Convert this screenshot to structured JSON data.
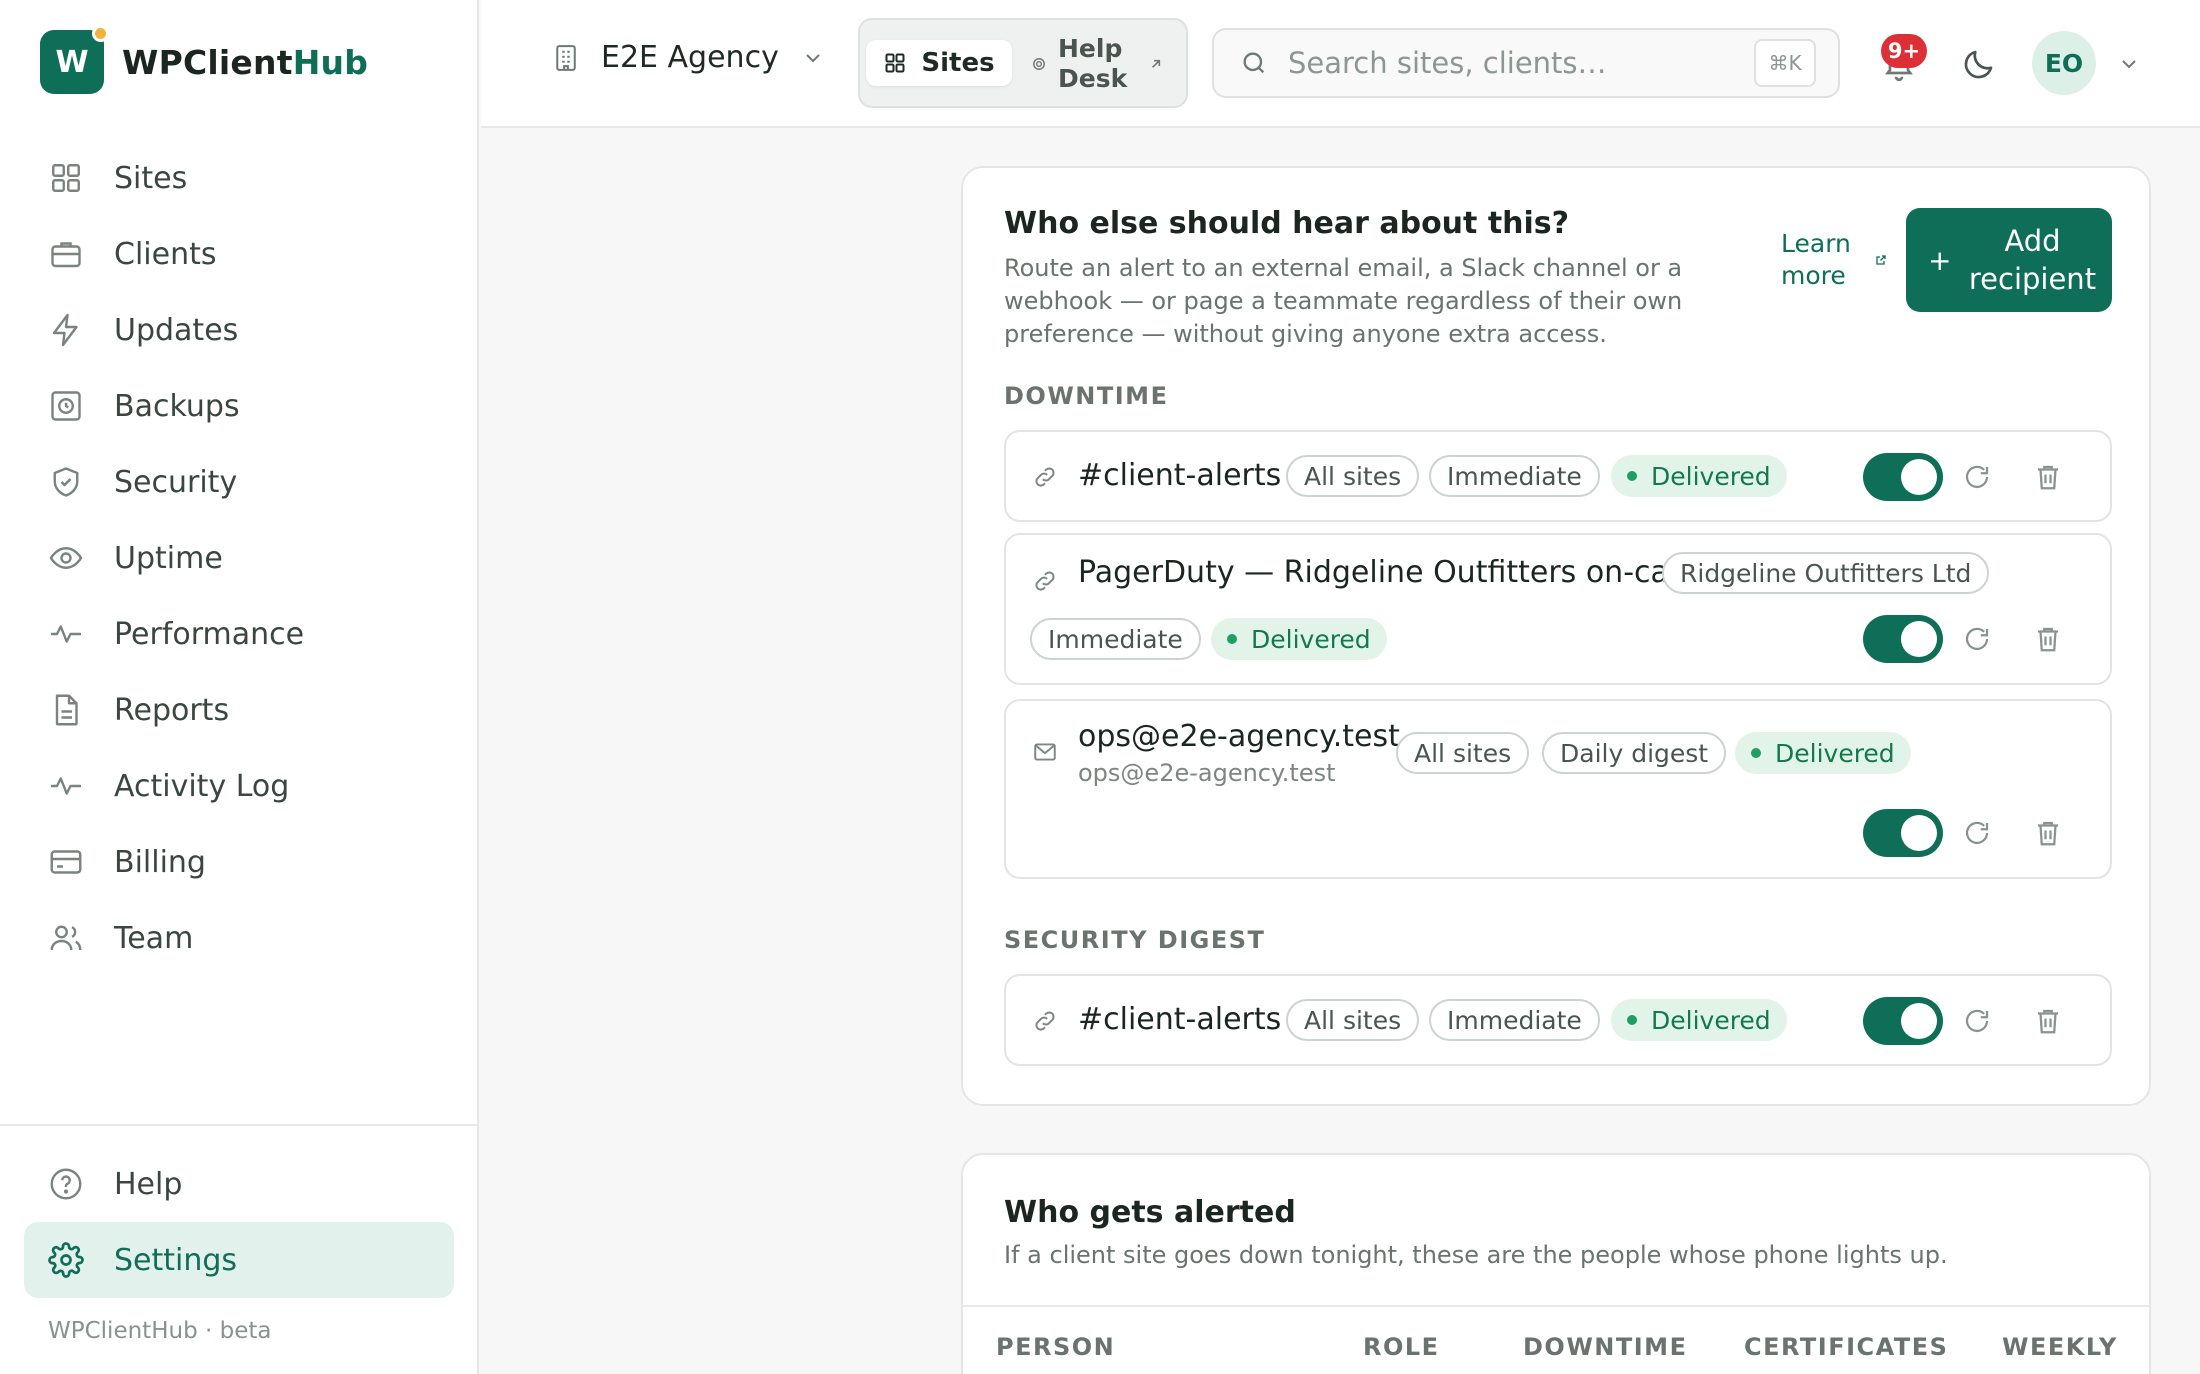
{
  "brand": {
    "mark": "W",
    "name_part1": "WPClient",
    "name_part2": "Hub"
  },
  "sidebar": {
    "items": [
      {
        "label": "Sites",
        "icon": "grid-icon"
      },
      {
        "label": "Clients",
        "icon": "briefcase-icon"
      },
      {
        "label": "Updates",
        "icon": "bolt-icon"
      },
      {
        "label": "Backups",
        "icon": "backup-icon"
      },
      {
        "label": "Security",
        "icon": "shield-icon"
      },
      {
        "label": "Uptime",
        "icon": "eye-icon"
      },
      {
        "label": "Performance",
        "icon": "pulse-icon"
      },
      {
        "label": "Reports",
        "icon": "document-icon"
      },
      {
        "label": "Activity Log",
        "icon": "activity-icon"
      },
      {
        "label": "Billing",
        "icon": "card-icon"
      },
      {
        "label": "Team",
        "icon": "users-icon"
      }
    ],
    "bottom": [
      {
        "label": "Help",
        "icon": "help-circle-icon"
      },
      {
        "label": "Settings",
        "icon": "gear-icon",
        "active": true
      }
    ],
    "footer": "WPClientHub · beta"
  },
  "topbar": {
    "agency": "E2E Agency",
    "seg_sites": "Sites",
    "seg_help": "Help Desk",
    "search_placeholder": "Search sites, clients…",
    "search_shortcut": "⌘K",
    "notif_badge": "9+",
    "avatar_initials": "EO"
  },
  "recipients_card": {
    "title": "Who else should hear about this?",
    "description": "Route an alert to an external email, a Slack channel or a webhook — or page a teammate regardless of their own preference — without giving anyone extra access.",
    "learn_more": "Learn more",
    "add_button": "Add recipient",
    "sections": [
      {
        "heading": "DOWNTIME",
        "rows": [
          {
            "name": "#client-alerts",
            "type": "link",
            "tags": [
              "All sites",
              "Immediate"
            ],
            "status": "Delivered",
            "enabled": true
          },
          {
            "name": "PagerDuty — Ridgeline Outfitters on-call",
            "type": "link",
            "tags": [
              "Ridgeline Outfitters Ltd",
              "Immediate"
            ],
            "status": "Delivered",
            "enabled": true
          },
          {
            "name": "ops@e2e-agency.test",
            "sub": "ops@e2e-agency.test",
            "type": "email",
            "tags": [
              "All sites",
              "Daily digest"
            ],
            "status": "Delivered",
            "enabled": true
          }
        ]
      },
      {
        "heading": "SECURITY DIGEST",
        "rows": [
          {
            "name": "#client-alerts",
            "type": "link",
            "tags": [
              "All sites",
              "Immediate"
            ],
            "status": "Delivered",
            "enabled": true
          }
        ]
      }
    ]
  },
  "alerted_card": {
    "title": "Who gets alerted",
    "description": "If a client site goes down tonight, these are the people whose phone lights up.",
    "columns": [
      "PERSON",
      "ROLE",
      "DOWNTIME",
      "CERTIFICATES",
      "WEEKLY"
    ]
  },
  "colors": {
    "accent": "#0f6e57",
    "success": "#1ea05f",
    "badge": "#dc2f36"
  }
}
